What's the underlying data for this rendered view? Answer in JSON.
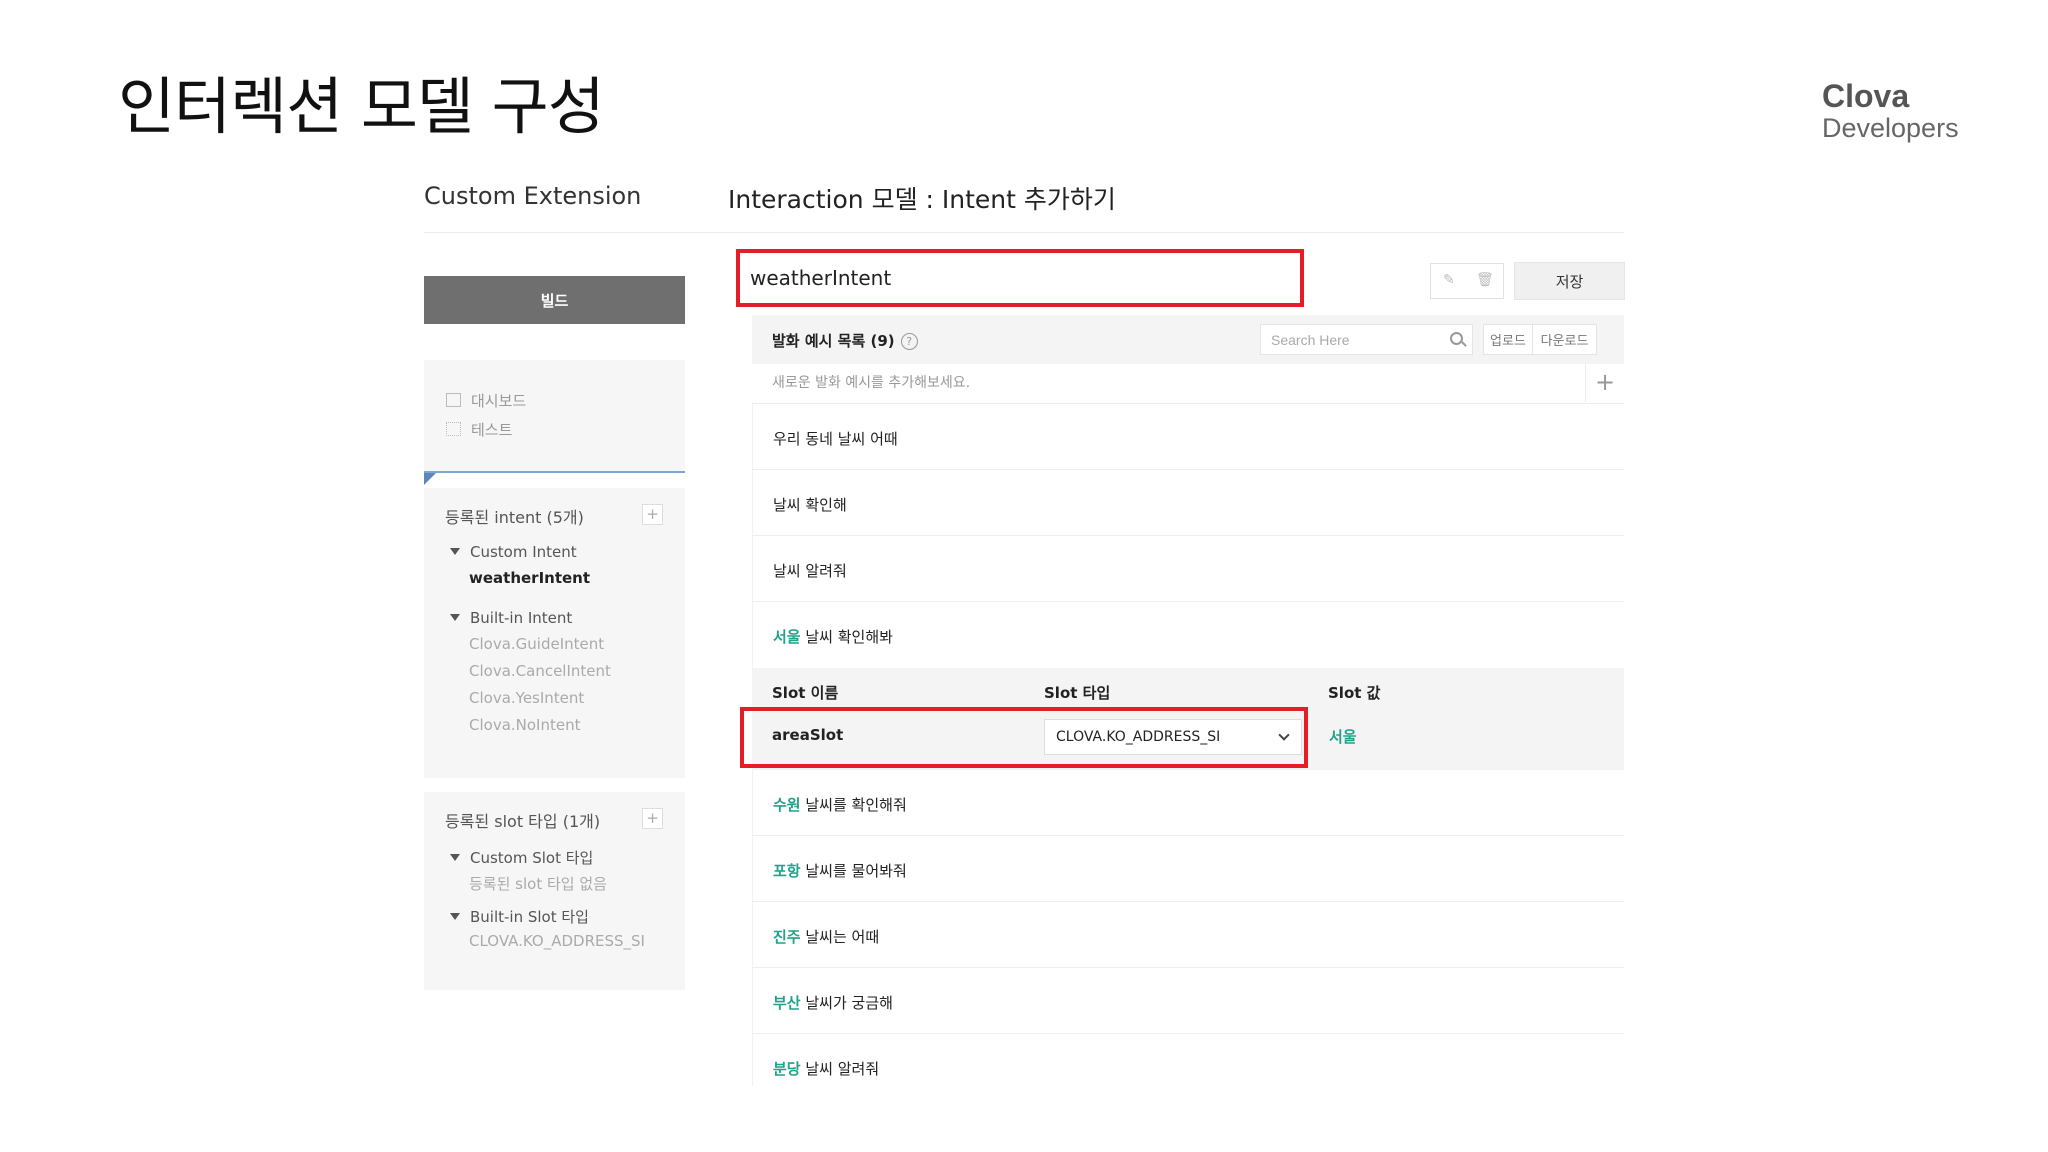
{
  "slide": {
    "title": "인터렉션 모델 구성",
    "logo_line1": "Clova",
    "logo_line2": "Developers"
  },
  "panel_labels": {
    "extension": "Custom Extension",
    "model": "Interaction 모델 : Intent 추가하기"
  },
  "sidebar": {
    "build_button": "빌드",
    "nav": [
      {
        "label": "대시보드",
        "icon": "dashboard-icon"
      },
      {
        "label": "테스트",
        "icon": "list-icon"
      }
    ],
    "intents": {
      "title": "등록된 intent (5개)",
      "add_icon": "+",
      "groups": [
        {
          "name": "Custom Intent",
          "items": [
            "weatherIntent"
          ]
        },
        {
          "name": "Built-in Intent",
          "items": [
            "Clova.GuideIntent",
            "Clova.CancelIntent",
            "Clova.YesIntent",
            "Clova.NoIntent"
          ]
        }
      ]
    },
    "slot_types": {
      "title": "등록된 slot 타입 (1개)",
      "add_icon": "+",
      "groups": [
        {
          "name": "Custom Slot 타입",
          "items": [
            "등록된 slot 타입 없음"
          ]
        },
        {
          "name": "Built-in Slot 타입",
          "items": [
            "CLOVA.KO_ADDRESS_SI"
          ]
        }
      ]
    }
  },
  "intent_editor": {
    "intent_name": "weatherIntent",
    "edit_icon": "pencil-icon",
    "delete_icon": "trash-icon",
    "save_button": "저장",
    "utterances_title": "발화 예시 목록 (9)",
    "help_icon": "?",
    "search_placeholder": "Search Here",
    "upload_button": "업로드",
    "download_button": "다운로드",
    "new_utterance_placeholder": "새로운 발화 예시를 추가해보세요.",
    "add_icon": "+",
    "utterances": [
      {
        "slot": "",
        "text": "우리 동네 날씨 어때"
      },
      {
        "slot": "",
        "text": "날씨 확인해"
      },
      {
        "slot": "",
        "text": "날씨 알려줘"
      },
      {
        "slot": "서울",
        "text": " 날씨 확인해봐"
      },
      {
        "slot": "수원",
        "text": " 날씨를 확인해줘"
      },
      {
        "slot": "포항",
        "text": " 날씨를 물어봐줘"
      },
      {
        "slot": "진주",
        "text": " 날씨는 어때"
      },
      {
        "slot": "부산",
        "text": " 날씨가 궁금해"
      },
      {
        "slot": "분당",
        "text": " 날씨 알려줘"
      }
    ],
    "slot_table": {
      "col_name": "Slot 이름",
      "col_type": "Slot 타입",
      "col_value": "Slot 값",
      "row": {
        "name": "areaSlot",
        "type": "CLOVA.KO_ADDRESS_SI",
        "value": "서울"
      }
    }
  },
  "colors": {
    "highlight_box": "#e41e26",
    "slot_green": "#1fa38a",
    "build_button": "#6f6f6f"
  }
}
